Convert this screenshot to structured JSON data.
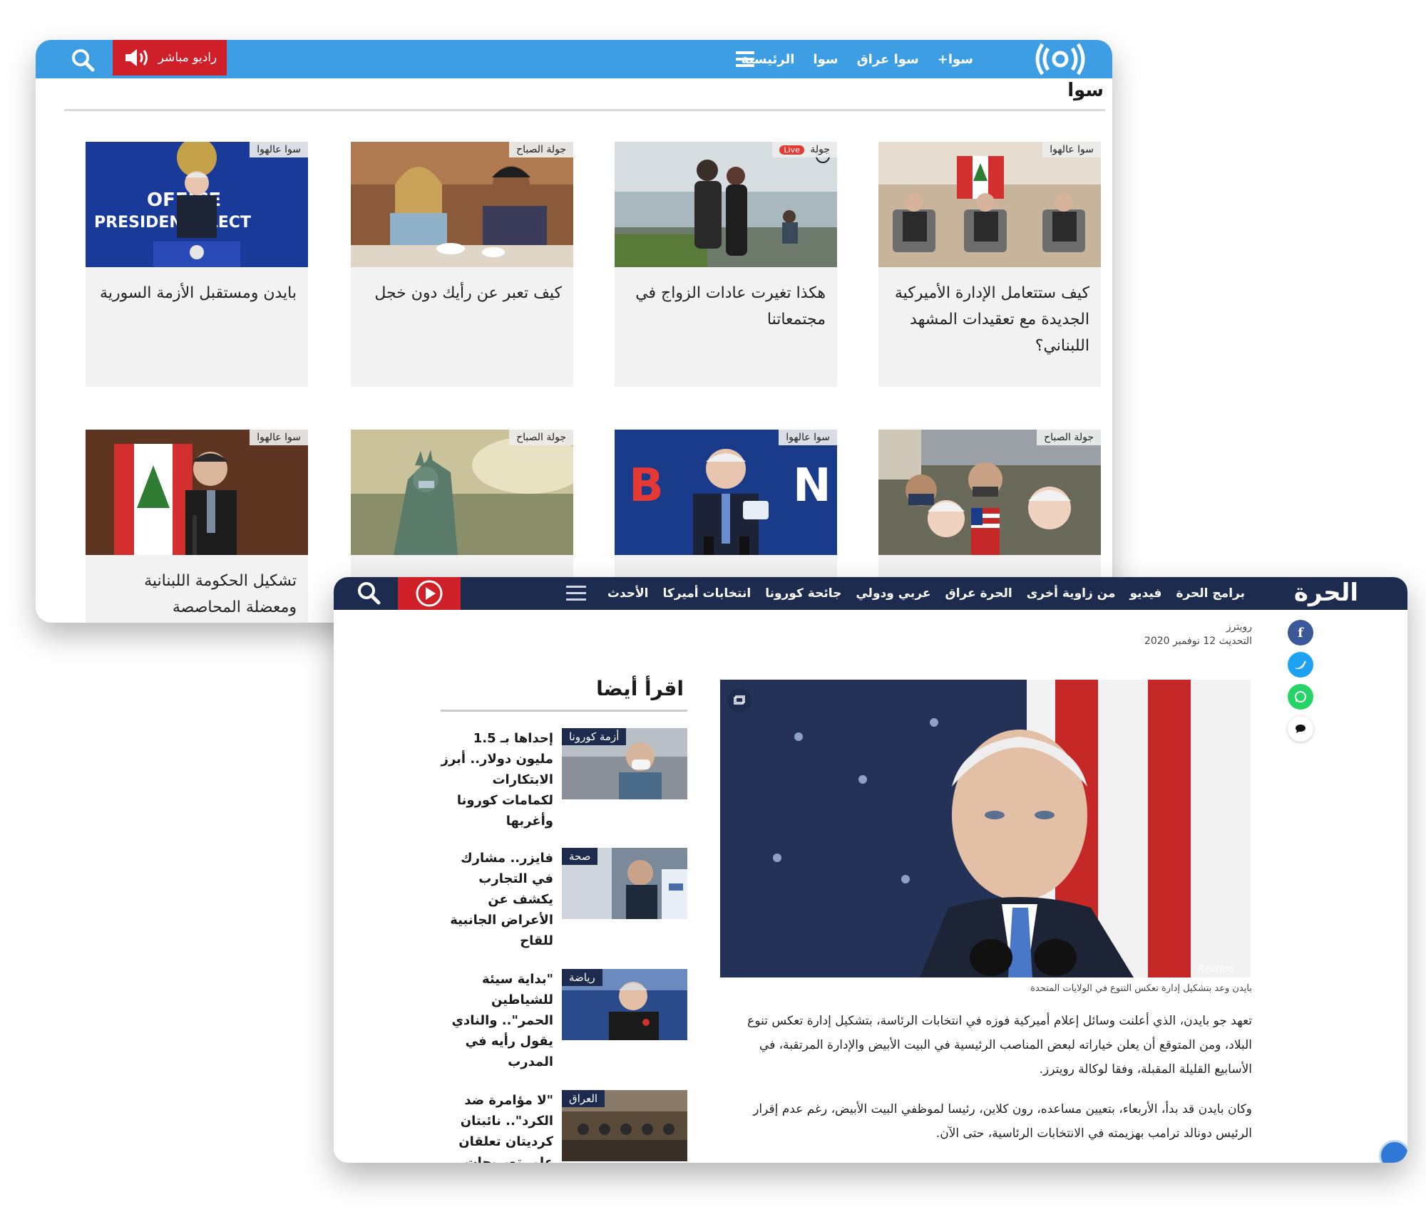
{
  "sawa": {
    "radio_label": "راديو مباشر",
    "nav": [
      "الرئيسية",
      "سوا",
      "سوا عراق",
      "سوا+"
    ],
    "heading": "سوا",
    "cards": [
      {
        "tag": "سوا عالهوا",
        "title": "كيف ستتعامل الإدارة الأميركية الجديدة مع تعقيدات المشهد اللبناني؟"
      },
      {
        "tag": "جولة",
        "live": "Live",
        "title": "هكذا تغيرت عادات الزواج في مجتمعاتنا"
      },
      {
        "tag": "جولة الصباح",
        "title": "كيف تعبر عن رأيك دون خجل"
      },
      {
        "tag": "سوا عالهوا",
        "title": "بايدن ومستقبل الأزمة السورية"
      },
      {
        "tag": "جولة الصباح",
        "title": ""
      },
      {
        "tag": "سوا عالهوا",
        "title": ""
      },
      {
        "tag": "جولة الصباح",
        "title": ""
      },
      {
        "tag": "سوا عالهوا",
        "title": "تشكيل الحكومة اللبنانية ومعضلة المحاصصة"
      }
    ],
    "thumb_text": {
      "office": "OFFICE",
      "elect": "PRESIDENT-ELECT"
    }
  },
  "hurra": {
    "logo": "الحرة",
    "nav": [
      "الأحدث",
      "انتخابات أميركا",
      "جائحة كورونا",
      "عربي ودولي",
      "الحرة عراق",
      "من زاوية أخرى",
      "فيديو",
      "برامج الحرة"
    ],
    "byline": {
      "source": "رويترز",
      "updated": "التحديث 12 نوفمبر 2020"
    },
    "photo_credit": "Reuters",
    "caption": "بايدن وعد بتشكيل إدارة تعكس التنوع في الولايات المتحدة",
    "paragraphs": [
      "تعهد جو بايدن، الذي أعلنت وسائل إعلام أميركية فوزه في انتخابات الرئاسة، بتشكيل إدارة تعكس تنوع البلاد، ومن المتوقع أن يعلن خياراته لبعض المناصب الرئيسية في البيت الأبيض والإدارة المرتقبة، في الأسابيع القليلة المقبلة، وفقا لوكالة رويترز.",
      "وكان بايدن قد بدأ، الأربعاء، بتعيين مساعده، رون كلاين، رئيسا لموظفي البيت الأبيض، رغم عدم إقرار الرئيس دونالد ترامب بهزيمته في الانتخابات الرئاسية، حتى الآن."
    ],
    "read_also": {
      "title": "اقرأ أيضا",
      "items": [
        {
          "badge": "أزمة كورونا",
          "text": "إحداها بـ 1.5 مليون دولار.. أبرز الابتكارات لكمامات كورونا وأغربها"
        },
        {
          "badge": "صحة",
          "text": "فايزر.. مشارك في التجارب يكشف عن الأعراض الجانبية للقاح"
        },
        {
          "badge": "رياضة",
          "text": "\"بداية سيئة للشياطين الحمر\".. والنادي يقول رأيه في المدرب"
        },
        {
          "badge": "العراق",
          "text": "\"لا مؤامرة ضد الكرد\".. نائبتان كرديتان تعلقان على تصريحات بيزن"
        }
      ]
    }
  },
  "colors": {
    "sawa_blue": "#3d9ee4",
    "radio_red": "#cf1f28",
    "hurra_navy": "#1d2b4f",
    "facebook": "#3b5998",
    "twitter": "#1da1f2",
    "whatsapp": "#25d366"
  },
  "icons": [
    "search-icon",
    "speaker-icon",
    "menu-icon",
    "sawa-logo-icon",
    "play-icon",
    "facebook-icon",
    "twitter-icon",
    "whatsapp-icon",
    "comment-icon",
    "gallery-icon",
    "help-icon"
  ]
}
